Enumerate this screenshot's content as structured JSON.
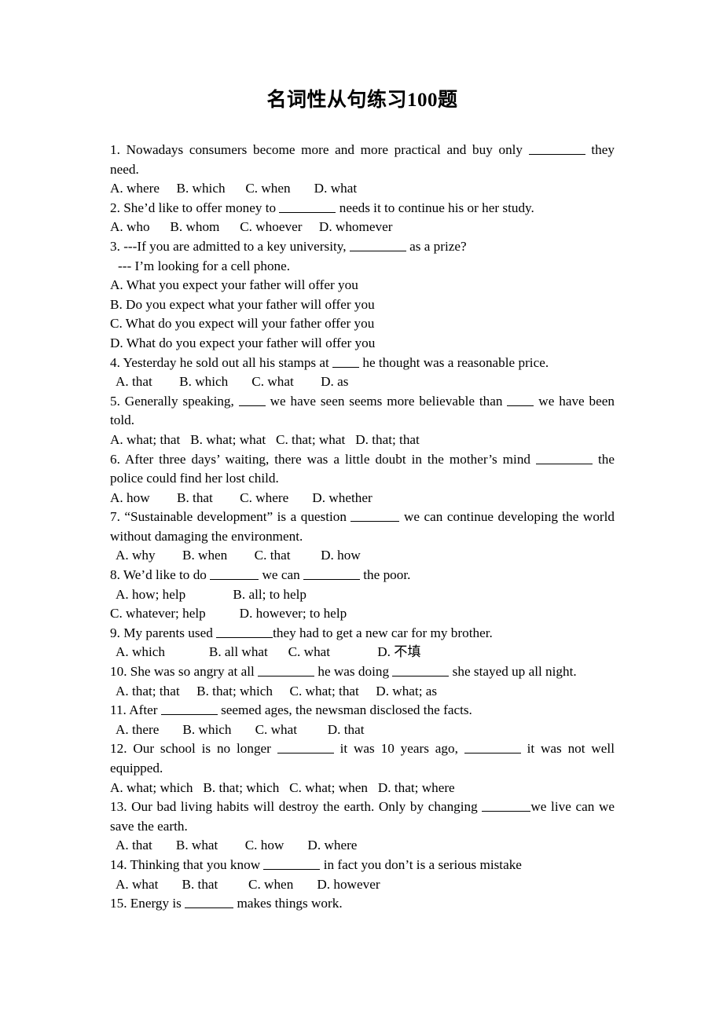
{
  "document": {
    "title": "名词性从句练习100题",
    "questions": [
      {
        "number": "1.",
        "stem_part1": "1. Nowadays consumers become more and more practical and buy only ",
        "stem_part2": " they need.",
        "options_line": "A. where     B. which      C. when       D. what",
        "options": [
          "A. where",
          "B. which",
          "C. when",
          "D. what"
        ]
      },
      {
        "number": "2.",
        "stem_part1": "2. She’d like to offer money to ",
        "stem_part2": " needs it to continue his or her study.",
        "options_line": "A. who      B. whom      C. whoever     D. whomever",
        "options": [
          "A. who",
          "B. whom",
          "C. whoever",
          "D. whomever"
        ]
      },
      {
        "number": "3.",
        "stem_part1": "3. ---If you are admitted to a key university, ",
        "stem_part2": " as a prize?",
        "dialog_line": "--- I’m looking for a cell phone.",
        "options": [
          "A. What you expect your father will offer you",
          "B. Do you expect what your father will offer you",
          "C. What do you expect will your father offer you",
          "D. What do you expect your father will offer you"
        ]
      },
      {
        "number": "4.",
        "stem_part1": "4. Yesterday he sold out all his stamps at ",
        "stem_part2": " he thought was a reasonable price.",
        "options_line": "A. that        B. which       C. what        D. as",
        "options": [
          "A. that",
          "B. which",
          "C. what",
          "D. as"
        ]
      },
      {
        "number": "5.",
        "stem_part1": "5. Generally speaking, ",
        "stem_mid": " we have seen seems more believable than ",
        "stem_part2": " we have been told.",
        "options_line": "A. what; that   B. what; what   C. that; what   D. that; that",
        "options": [
          "A. what; that",
          "B. what; what",
          "C. that; what",
          "D. that; that"
        ]
      },
      {
        "number": "6.",
        "stem_part1": "6. After three days’ waiting, there was a little doubt in the mother’s mind ",
        "stem_part2": " the police could find her lost child.",
        "options_line": "A. how        B. that        C. where       D. whether",
        "options": [
          "A. how",
          "B. that",
          "C. where",
          "D. whether"
        ]
      },
      {
        "number": "7.",
        "stem_part1": "7. “Sustainable development” is a question ",
        "stem_part2": " we can continue developing the world without damaging the environment.",
        "options_line": "A. why        B. when        C. that         D. how",
        "options": [
          "A. why",
          "B. when",
          "C. that",
          "D. how"
        ]
      },
      {
        "number": "8.",
        "stem_part1": "8. We’d like to do ",
        "stem_mid": " we can ",
        "stem_part2": " the poor.",
        "options_line1": "A. how; help              B. all; to help",
        "options_line2": "C. whatever; help          D. however; to help",
        "options": [
          "A. how; help",
          "B. all; to help",
          "C. whatever; help",
          "D. however; to help"
        ]
      },
      {
        "number": "9.",
        "stem_part1": "9. My parents used ",
        "stem_part2": "they had to get a new car for my brother.",
        "options_line": "A. which             B. all what      C. what              D. 不填",
        "options": [
          "A. which",
          "B. all what",
          "C. what",
          "D. 不填"
        ]
      },
      {
        "number": "10.",
        "stem_part1": "10. She was so angry at all ",
        "stem_mid": " he was doing ",
        "stem_part2": " she stayed up all night.",
        "options_line": "A. that; that     B. that; which     C. what; that     D. what; as",
        "options": [
          "A. that; that",
          "B. that; which",
          "C. what; that",
          "D. what; as"
        ]
      },
      {
        "number": "11.",
        "stem_part1": "11. After ",
        "stem_part2": " seemed ages, the newsman disclosed the facts.",
        "options_line": "A. there       B. which       C. what         D. that",
        "options": [
          "A. there",
          "B. which",
          "C. what",
          "D. that"
        ]
      },
      {
        "number": "12.",
        "stem_part1": "12. Our school is no longer ",
        "stem_mid": " it was 10 years ago, ",
        "stem_part2": " it was not well equipped.",
        "options_line": "A. what; which   B. that; which   C. what; when   D. that; where",
        "options": [
          "A. what; which",
          "B. that; which",
          "C. what; when",
          "D. that; where"
        ]
      },
      {
        "number": "13.",
        "stem_part1": "13. Our bad living habits will destroy the earth. Only by changing ",
        "stem_part2": "we live can we save the earth.",
        "options_line": "A. that       B. what        C. how       D. where",
        "options": [
          "A. that",
          "B. what",
          "C. how",
          "D. where"
        ]
      },
      {
        "number": "14.",
        "stem_part1": "14. Thinking that you know ",
        "stem_part2": " in fact you don’t is a serious mistake",
        "options_line": "A. what       B. that         C. when       D. however",
        "options": [
          "A. what",
          "B. that",
          "C. when",
          "D. however"
        ]
      },
      {
        "number": "15.",
        "stem_part1": "15. Energy is ",
        "stem_part2": " makes things work.",
        "options": []
      }
    ]
  }
}
